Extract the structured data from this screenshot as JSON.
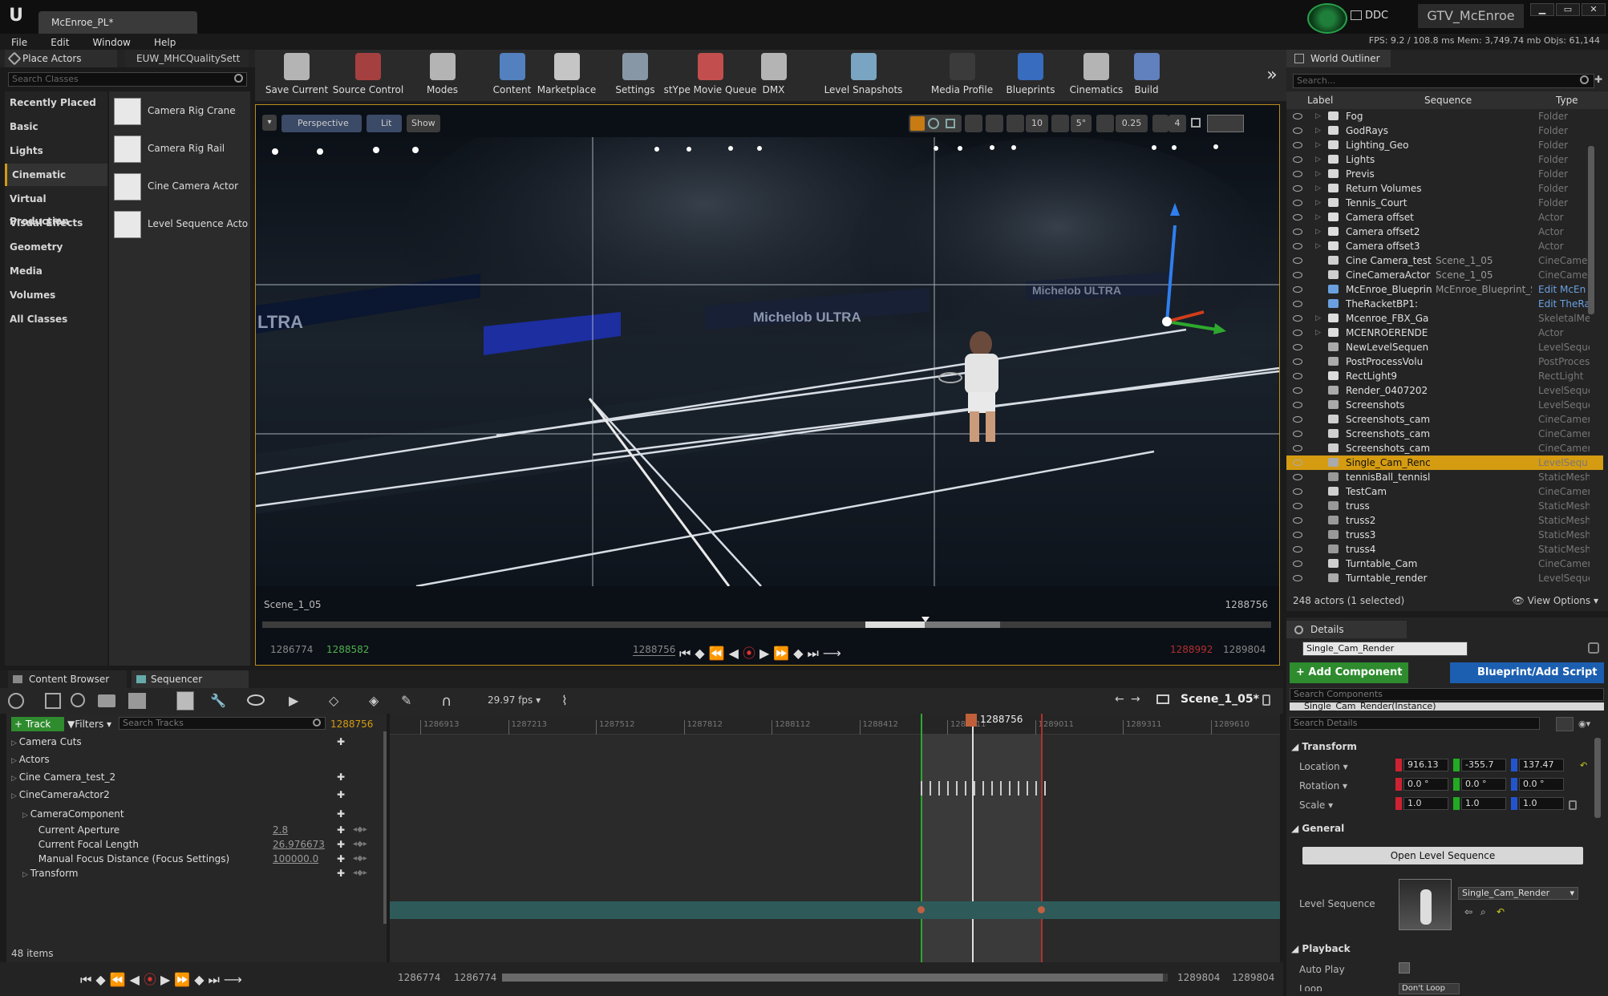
{
  "window": {
    "doc_tab": "McEnroe_PL*",
    "ddc_label": "DDC",
    "project_name": "GTV_McEnroe",
    "minimize": "▁",
    "maximize": "▭",
    "close": "✕"
  },
  "menu": [
    "File",
    "Edit",
    "Window",
    "Help"
  ],
  "perf": {
    "text": "FPS: 9.2  /  108.8 ms   Mem: 3,749.74 mb   Objs: 61,144"
  },
  "place_actors": {
    "tab_label": "Place Actors",
    "second_tab": "EUW_MHCQualitySett",
    "search_placeholder": "Search Classes",
    "categories": [
      "Recently Placed",
      "Basic",
      "Lights",
      "Cinematic",
      "Virtual Production",
      "Visual Effects",
      "Geometry",
      "Media",
      "Volumes",
      "All Classes"
    ],
    "selected_category": "Cinematic",
    "items": [
      "Camera Rig Crane",
      "Camera Rig Rail",
      "Cine Camera Actor",
      "Level Sequence Acto"
    ]
  },
  "toolbar": [
    "Save Current",
    "Source Control",
    "Modes",
    "Content",
    "Marketplace",
    "Settings",
    "stYpe Movie Queue",
    "DMX",
    "Level Snapshots",
    "Media Profile",
    "Blueprints",
    "Cinematics",
    "Build"
  ],
  "viewport": {
    "menu_arrow": "▾",
    "perspective": "Perspective",
    "lit": "Lit",
    "show": "Show",
    "snap_value_1": "10",
    "snap_value_2": "5°",
    "snap_value_3": "0.25",
    "camera_speed": "4",
    "scene_label": "Scene_1_05",
    "frame_right": "1288756",
    "banner_text_1": "Michelob ULTRA",
    "banner_text_2": "Michelob ULTRA",
    "banner_text_3": "LTRA",
    "transport": {
      "start": "1286774",
      "in": "1288582",
      "current": "1288756",
      "out": "1288992",
      "end": "1289804"
    }
  },
  "outliner": {
    "tab_label": "World Outliner",
    "search_placeholder": "Search...",
    "col_label": "Label",
    "col_sequence": "Sequence",
    "col_type": "Type",
    "rows": [
      {
        "label": "Fog",
        "seq": "",
        "type": "Folder",
        "kind": "folder"
      },
      {
        "label": "GodRays",
        "seq": "",
        "type": "Folder",
        "kind": "folder"
      },
      {
        "label": "Lighting_Geo",
        "seq": "",
        "type": "Folder",
        "kind": "folder"
      },
      {
        "label": "Lights",
        "seq": "",
        "type": "Folder",
        "kind": "folder"
      },
      {
        "label": "Previs",
        "seq": "",
        "type": "Folder",
        "kind": "folder"
      },
      {
        "label": "Return Volumes",
        "seq": "",
        "type": "Folder",
        "kind": "folder"
      },
      {
        "label": "Tennis_Court",
        "seq": "",
        "type": "Folder",
        "kind": "folder"
      },
      {
        "label": "Camera offset",
        "seq": "",
        "type": "Actor",
        "kind": "actor"
      },
      {
        "label": "Camera offset2",
        "seq": "",
        "type": "Actor",
        "kind": "actor"
      },
      {
        "label": "Camera offset3",
        "seq": "",
        "type": "Actor",
        "kind": "actor"
      },
      {
        "label": "Cine Camera_test",
        "seq": "Scene_1_05",
        "type": "CineCamer",
        "kind": "cam"
      },
      {
        "label": "CineCameraActor",
        "seq": "Scene_1_05",
        "type": "CineCamer",
        "kind": "cam"
      },
      {
        "label": "McEnroe_Blueprin",
        "seq": "McEnroe_Blueprint_Scene_",
        "type": "Edit McEn",
        "kind": "bp"
      },
      {
        "label": "TheRacketBP1:",
        "seq": "",
        "type": "Edit TheRa",
        "kind": "bp"
      },
      {
        "label": "Mcenroe_FBX_Ga",
        "seq": "",
        "type": "SkeletalMe",
        "kind": "actor"
      },
      {
        "label": "MCENROERENDE",
        "seq": "",
        "type": "Actor",
        "kind": "actor"
      },
      {
        "label": "NewLevelSequen",
        "seq": "",
        "type": "LevelSeque",
        "kind": "seq"
      },
      {
        "label": "PostProcessVolu",
        "seq": "",
        "type": "PostProces",
        "kind": "seq"
      },
      {
        "label": "RectLight9",
        "seq": "",
        "type": "RectLight",
        "kind": "light"
      },
      {
        "label": "Render_0407202",
        "seq": "",
        "type": "LevelSeque",
        "kind": "seq"
      },
      {
        "label": "Screenshots",
        "seq": "",
        "type": "LevelSeque",
        "kind": "seq"
      },
      {
        "label": "Screenshots_cam",
        "seq": "",
        "type": "CineCamer",
        "kind": "cam"
      },
      {
        "label": "Screenshots_cam",
        "seq": "",
        "type": "CineCamer",
        "kind": "cam"
      },
      {
        "label": "Screenshots_cam",
        "seq": "",
        "type": "CineCamer",
        "kind": "cam"
      },
      {
        "label": "Single_Cam_Renc",
        "seq": "",
        "type": "LevelSequ",
        "kind": "seq",
        "selected": true
      },
      {
        "label": "tennisBall_tennisl",
        "seq": "",
        "type": "StaticMesh",
        "kind": "mesh"
      },
      {
        "label": "TestCam",
        "seq": "",
        "type": "CineCamer",
        "kind": "cam"
      },
      {
        "label": "truss",
        "seq": "",
        "type": "StaticMesh",
        "kind": "mesh"
      },
      {
        "label": "truss2",
        "seq": "",
        "type": "StaticMesh",
        "kind": "mesh"
      },
      {
        "label": "truss3",
        "seq": "",
        "type": "StaticMesh",
        "kind": "mesh"
      },
      {
        "label": "truss4",
        "seq": "",
        "type": "StaticMesh",
        "kind": "mesh"
      },
      {
        "label": "Turntable_Cam",
        "seq": "",
        "type": "CineCamer",
        "kind": "cam"
      },
      {
        "label": "Turntable_render",
        "seq": "",
        "type": "LevelSeque",
        "kind": "seq"
      }
    ],
    "footer": "248 actors (1 selected)",
    "view_options": "View Options"
  },
  "details": {
    "tab_label": "Details",
    "name_value": "Single_Cam_Render",
    "add_component": "+ Add Component",
    "blueprint_script": "Blueprint/Add Script",
    "search_components": "Search Components",
    "instance_row": "Single_Cam_Render(Instance)",
    "search_details": "Search Details",
    "transform_header": "Transform",
    "location_label": "Location",
    "rotation_label": "Rotation",
    "scale_label": "Scale",
    "location": {
      "x": "916.13",
      "y": "-355.7",
      "z": "137.47"
    },
    "rotation": {
      "x": "0.0 °",
      "y": "0.0 °",
      "z": "0.0 °"
    },
    "scale": {
      "x": "1.0",
      "y": "1.0",
      "z": "1.0"
    },
    "general_header": "General",
    "open_sequence": "Open Level Sequence",
    "level_sequence_label": "Level Sequence",
    "level_sequence_value": "Single_Cam_Render",
    "playback_header": "Playback",
    "auto_play": "Auto Play",
    "loop": "Loop",
    "loop_value": "Don't Loop"
  },
  "sequencer": {
    "tab_content_browser": "Content Browser",
    "tab_sequencer": "Sequencer",
    "fps": "29.97 fps",
    "sequence_name": "Scene_1_05*",
    "track_button": "+ Track",
    "filters": "Filters",
    "search_tracks": "Search Tracks",
    "current_frame": "1288756",
    "playhead_frame": "1288756",
    "ruler_ticks": [
      "1286913",
      "1287213",
      "1287512",
      "1287812",
      "1288112",
      "1288412",
      "1288711",
      "1289011",
      "1289311",
      "1289610"
    ],
    "tracks": [
      {
        "label": "Camera Cuts",
        "indent": 0,
        "value": ""
      },
      {
        "label": "Actors",
        "indent": 0,
        "value": ""
      },
      {
        "label": "Cine Camera_test_2",
        "indent": 0,
        "value": ""
      },
      {
        "label": "CineCameraActor2",
        "indent": 0,
        "value": ""
      },
      {
        "label": "CameraComponent",
        "indent": 1,
        "value": ""
      },
      {
        "label": "Current Aperture",
        "indent": 2,
        "value": "2.8"
      },
      {
        "label": "Current Focal Length",
        "indent": 2,
        "value": "26.976673"
      },
      {
        "label": "Manual Focus Distance (Focus Settings)",
        "indent": 2,
        "value": "100000.0"
      },
      {
        "label": "Transform",
        "indent": 1,
        "value": ""
      }
    ],
    "items_count": "48 items",
    "range_start_1": "1286774",
    "range_start_2": "1286774",
    "range_end_1": "1289804",
    "range_end_2": "1289804"
  },
  "colors": {
    "accent": "#d59c12",
    "selection": "#d59c12",
    "add_green": "#2e8b2e",
    "blueprint_blue": "#1c5fb0",
    "track_teal": "#2e5a5a"
  }
}
